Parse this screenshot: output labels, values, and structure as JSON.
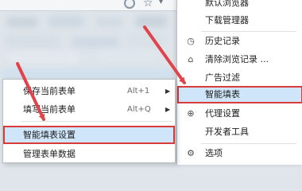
{
  "browser_menu": {
    "items": [
      {
        "label": "默认浏览器",
        "icon": ""
      },
      {
        "label": "下载管理器",
        "icon": ""
      },
      {
        "label": "历史记录",
        "icon": "clock-icon"
      },
      {
        "label": "清除浏览记录 ...",
        "icon": "broom-icon"
      },
      {
        "label": "广告过滤",
        "icon": ""
      },
      {
        "label": "智能填表",
        "icon": "",
        "highlighted": true
      },
      {
        "label": "代理设置",
        "icon": "globe-icon"
      },
      {
        "label": "开发者工具",
        "icon": ""
      },
      {
        "label": "选项",
        "icon": "gear-icon"
      }
    ]
  },
  "autofill_submenu": {
    "items": [
      {
        "label": "保存当前表单",
        "shortcut": "Alt+1",
        "has_arrow": true
      },
      {
        "label": "填写当前表单",
        "shortcut": "Alt+Q",
        "has_arrow": true
      },
      {
        "label": "智能填表设置",
        "highlighted": true
      },
      {
        "label": "管理表单数据"
      }
    ]
  },
  "colors": {
    "highlight_border": "#d93a3a",
    "highlight_bg": "#cfe6fa",
    "arrow": "#e0434a"
  }
}
